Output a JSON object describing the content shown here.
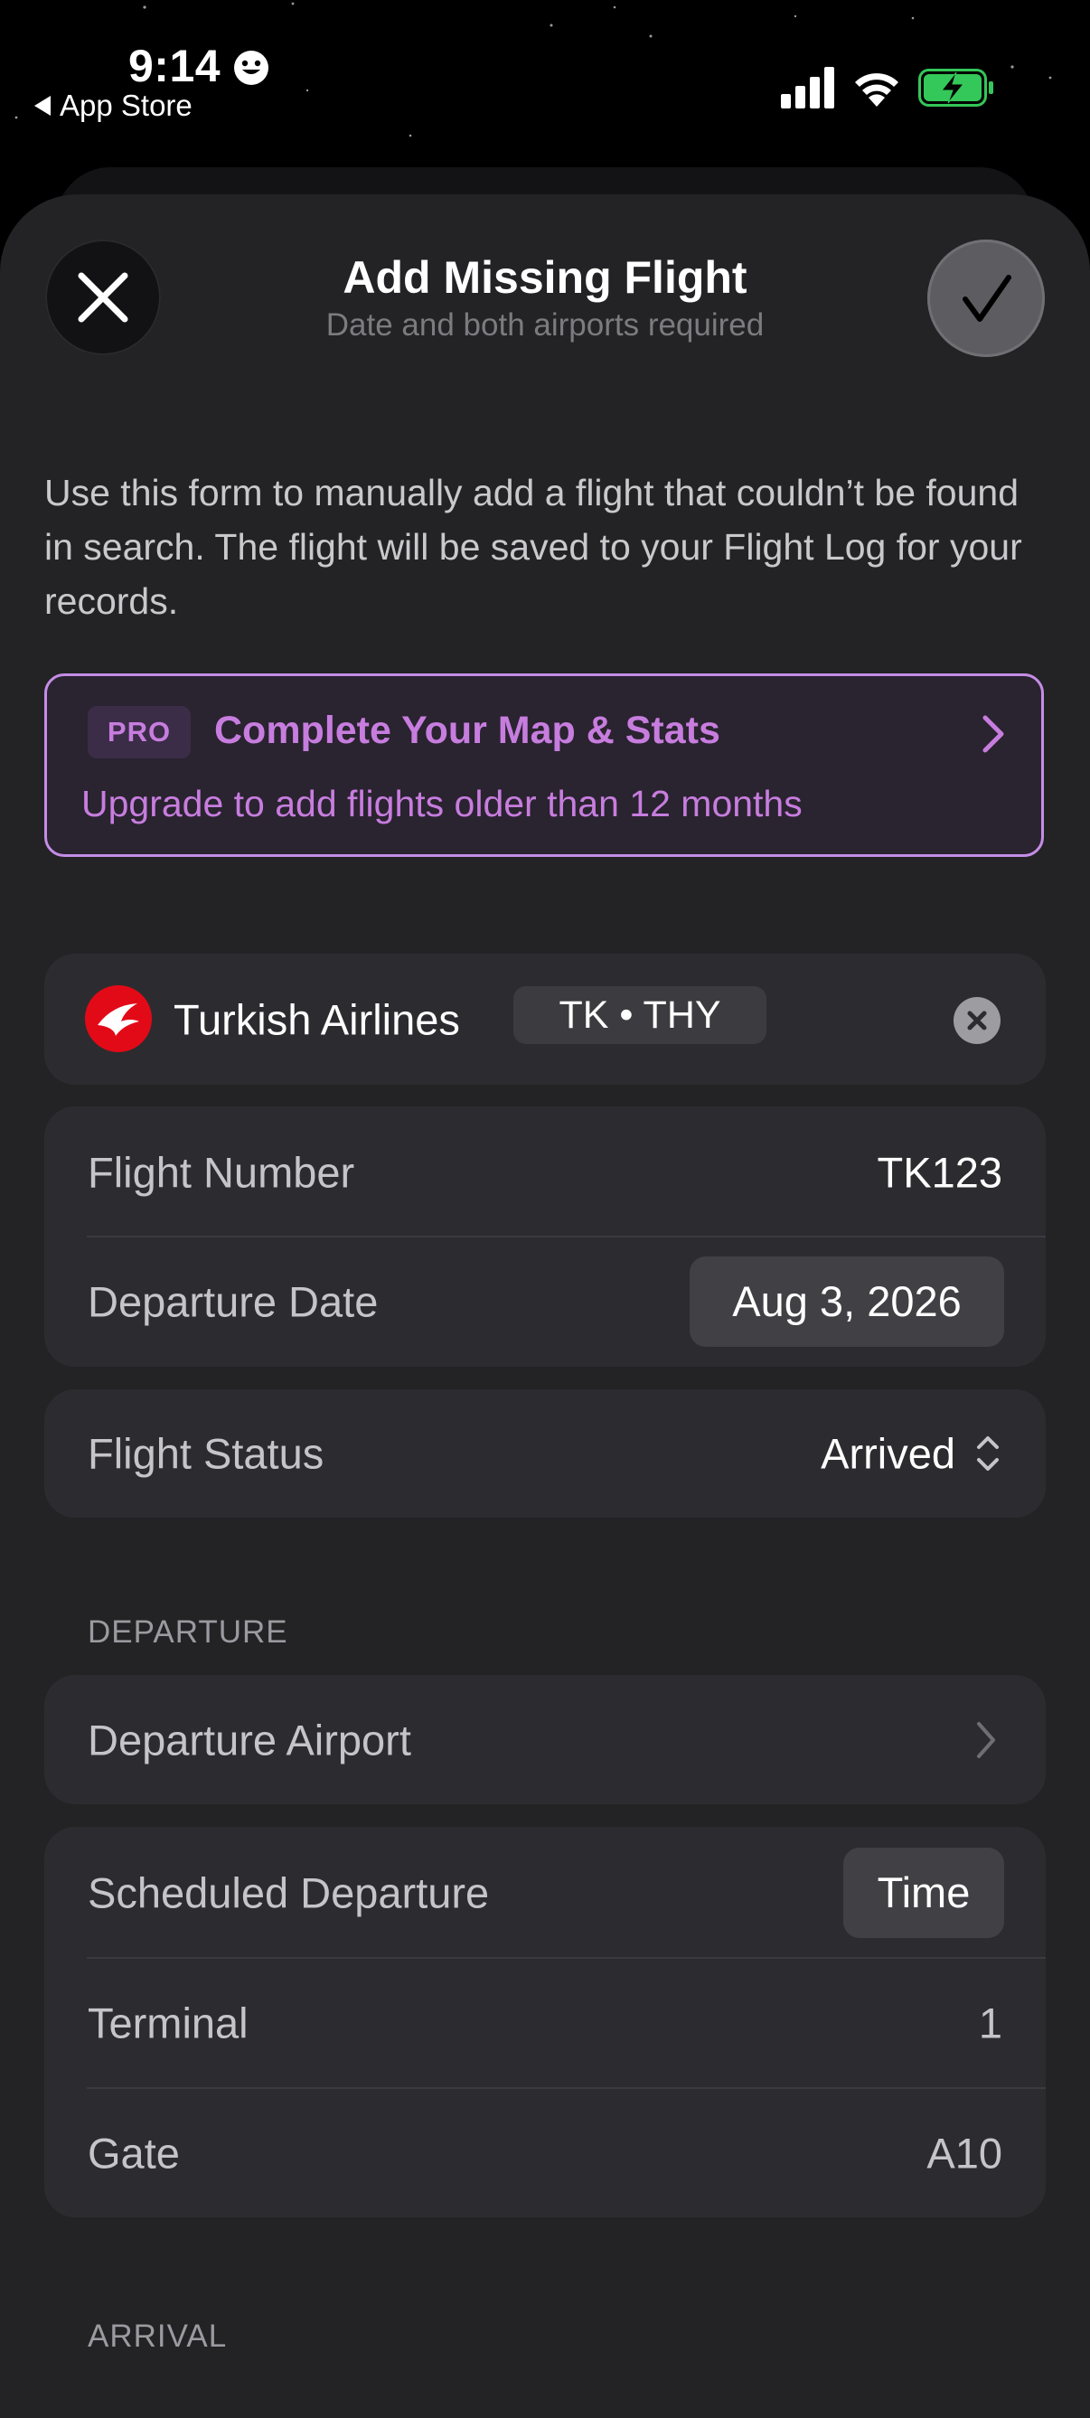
{
  "status_bar": {
    "time": "9:14",
    "back_app": "App Store"
  },
  "header": {
    "title": "Add Missing Flight",
    "subtitle": "Date and both airports required"
  },
  "intro_text": "Use this form to manually add a flight that couldn’t be found in search. The flight will be saved to your Flight Log for your records.",
  "promo": {
    "badge": "PRO",
    "title": "Complete Your Map & Stats",
    "subtitle": "Upgrade to add flights older than 12 months",
    "accent_color": "#c77dde"
  },
  "airline": {
    "name": "Turkish Airlines",
    "codes": "TK • THY",
    "logo_color": "#e30a17"
  },
  "flight_info": {
    "flight_number_label": "Flight Number",
    "flight_number_value": "TK123",
    "departure_date_label": "Departure Date",
    "departure_date_value": "Aug 3, 2026"
  },
  "flight_status": {
    "label": "Flight Status",
    "value": "Arrived"
  },
  "departure": {
    "section_title": "DEPARTURE",
    "airport_label": "Departure Airport",
    "scheduled_label": "Scheduled Departure",
    "scheduled_value": "Time",
    "terminal_label": "Terminal",
    "terminal_value": "1",
    "gate_label": "Gate",
    "gate_value": "A10"
  },
  "arrival": {
    "section_title": "ARRIVAL"
  }
}
